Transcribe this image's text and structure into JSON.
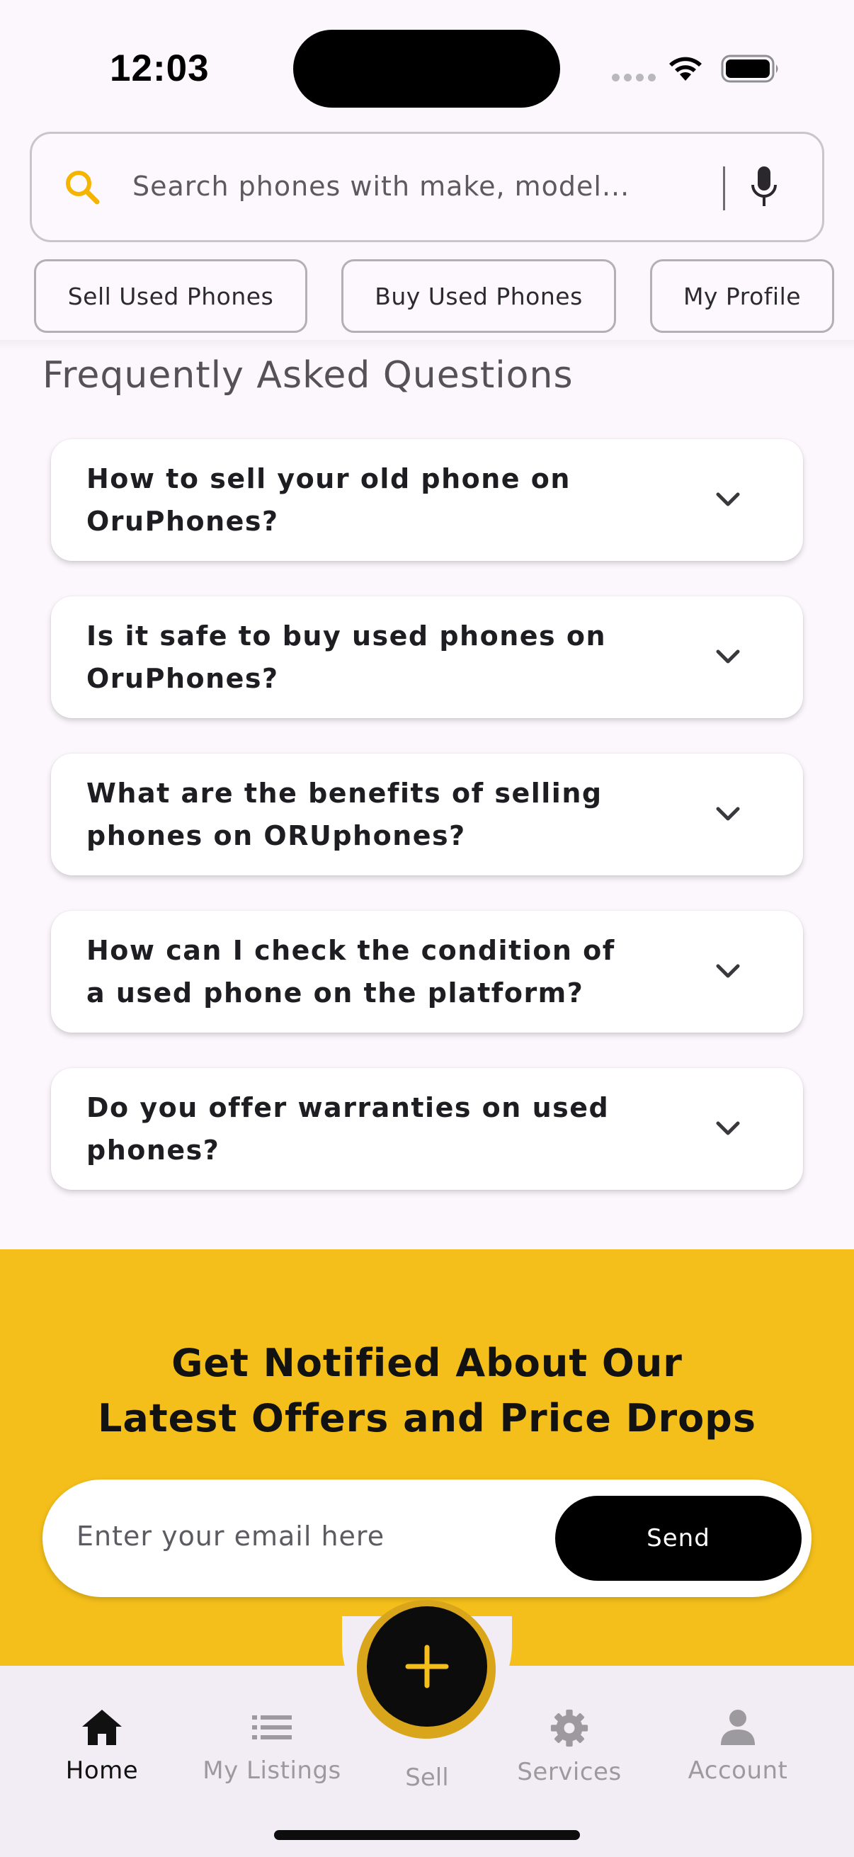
{
  "status_bar": {
    "time": "12:03"
  },
  "search": {
    "placeholder": "Search phones with make, model..."
  },
  "chips": [
    {
      "label": "Sell Used Phones"
    },
    {
      "label": "Buy Used Phones"
    },
    {
      "label": "My Profile"
    }
  ],
  "faq": {
    "title": "Frequently Asked Questions",
    "items": [
      {
        "question": "How to sell your old phone on OruPhones?"
      },
      {
        "question": "Is it safe to buy used phones on OruPhones?"
      },
      {
        "question": "What are the benefits of selling phones on ORUphones?"
      },
      {
        "question": "How can I check the condition of a used phone on the platform?"
      },
      {
        "question": "Do you offer warranties on used phones?"
      }
    ]
  },
  "newsletter": {
    "title_line1": "Get Notified About Our",
    "title_line2": "Latest Offers and Price Drops",
    "email_placeholder": "Enter your email here",
    "send_label": "Send"
  },
  "bottom_nav": {
    "items": [
      {
        "label": "Home",
        "icon": "home-icon",
        "active": true
      },
      {
        "label": "My Listings",
        "icon": "list-icon",
        "active": false
      },
      {
        "label": "Sell",
        "icon": "plus-icon",
        "active": false
      },
      {
        "label": "Services",
        "icon": "gear-icon",
        "active": false
      },
      {
        "label": "Account",
        "icon": "person-icon",
        "active": false
      }
    ]
  },
  "colors": {
    "background": "#fcf6fd",
    "accent_yellow": "#f4bf1a",
    "black": "#000000",
    "nav_background": "#f2edf4"
  }
}
